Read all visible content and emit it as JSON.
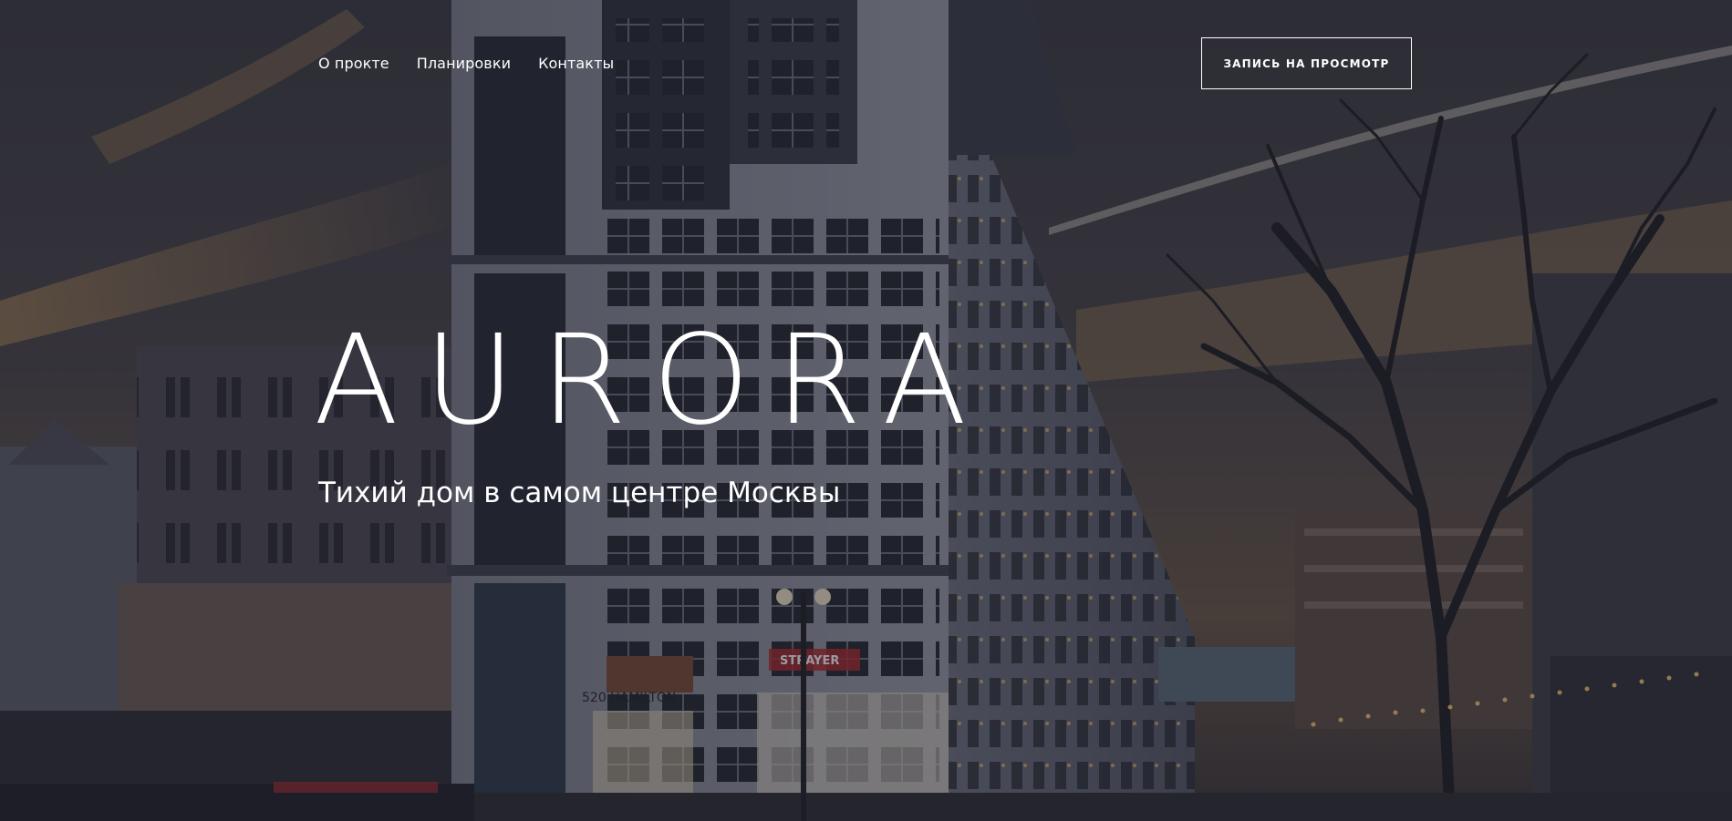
{
  "nav": {
    "items": [
      {
        "label": "О прокте"
      },
      {
        "label": "Планировки"
      },
      {
        "label": "Контакты"
      }
    ]
  },
  "cta": {
    "label": "ЗАПИСЬ НА ПРОСМОТР"
  },
  "hero": {
    "title": "AURORA",
    "subtitle": "Тихий дом в самом центре Москвы"
  },
  "building_signs": {
    "address": "520 HAMILTON",
    "store": "STRAYER"
  },
  "colors": {
    "overlay": "#1d1f2b",
    "sky_dark": "#3a3a44",
    "sky_glow": "#c89a5a",
    "building": "#8d8f9c",
    "text": "#ffffff"
  }
}
